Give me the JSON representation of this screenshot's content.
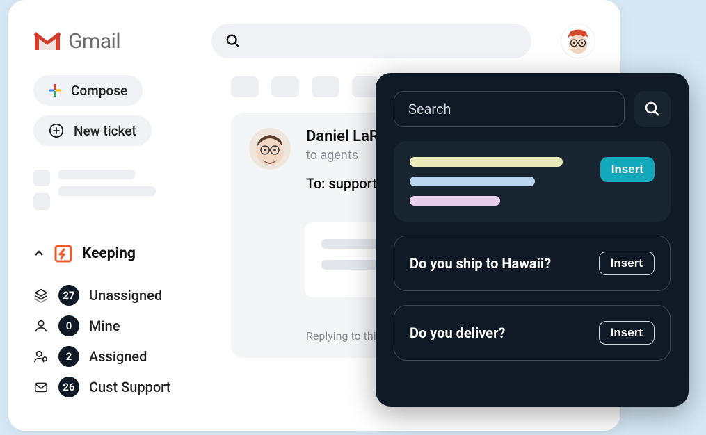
{
  "app": {
    "name": "Gmail"
  },
  "search": {
    "placeholder": ""
  },
  "compose": {
    "label": "Compose"
  },
  "newTicket": {
    "label": "New ticket"
  },
  "keeping": {
    "title": "Keeping",
    "items": [
      {
        "icon": "stack",
        "count": "27",
        "label": "Unassigned"
      },
      {
        "icon": "person",
        "count": "0",
        "label": "Mine"
      },
      {
        "icon": "persons",
        "count": "2",
        "label": "Assigned"
      },
      {
        "icon": "mail",
        "count": "26",
        "label": "Cust Support"
      }
    ]
  },
  "email": {
    "sender": "Daniel LaRu",
    "toline_small": "to agents",
    "toLine": "To: support@",
    "replyNote": "Replying to this no"
  },
  "panel": {
    "searchPlaceholder": "Search",
    "insertLabel": "Insert",
    "responses": [
      {
        "title": "Do you ship to Hawaii?"
      },
      {
        "title": "Do you deliver?"
      }
    ]
  }
}
